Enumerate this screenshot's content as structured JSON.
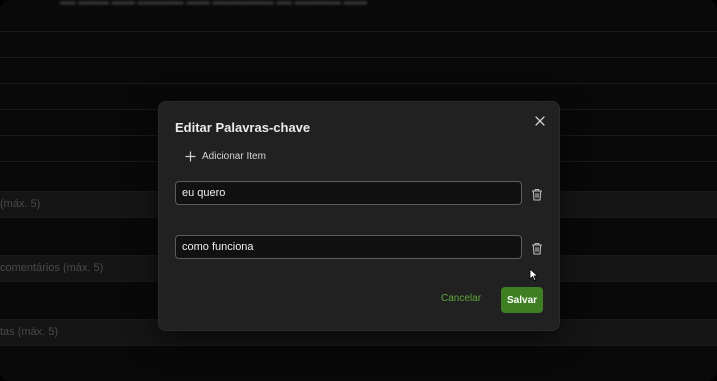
{
  "background": {
    "labels": [
      "(máx. 5)",
      "comentários (máx. 5)",
      "tas (máx. 5)"
    ]
  },
  "modal": {
    "title": "Editar Palavras-chave",
    "close_icon": "close-icon",
    "add_item_label": "Adicionar Item",
    "items": [
      {
        "value": "eu quero"
      },
      {
        "value": "como funciona"
      }
    ],
    "cancel_label": "Cancelar",
    "save_label": "Salvar"
  },
  "colors": {
    "accent_green": "#3f7f23",
    "cancel_text_green": "#5fa63e",
    "modal_bg": "#212121"
  }
}
